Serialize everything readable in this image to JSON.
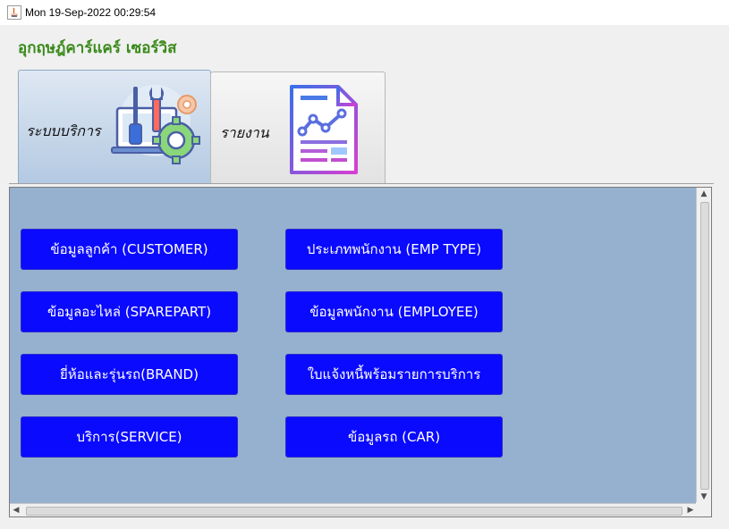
{
  "window": {
    "title": "Mon 19-Sep-2022  00:29:54"
  },
  "app": {
    "heading": "อุกฤษฎ์คาร์แคร์ เซอร์วิส",
    "heading_color": "#3a8a1a"
  },
  "tabs": [
    {
      "label": "ระบบบริการ",
      "icon": "tools-gear-icon",
      "selected": true
    },
    {
      "label": "รายงาน",
      "icon": "report-chart-icon",
      "selected": false
    }
  ],
  "panel": {
    "background": "#95b1cf",
    "buttons": [
      {
        "label": "ข้อมูลลูกค้า (CUSTOMER)"
      },
      {
        "label": "ประเภทพนักงาน (EMP TYPE)"
      },
      {
        "label": "ข้อมูลอะไหล่ (SPAREPART)"
      },
      {
        "label": "ข้อมูลพนักงาน (EMPLOYEE)"
      },
      {
        "label": "ยี่ห้อและรุ่นรถ(BRAND)"
      },
      {
        "label": "ใบแจ้งหนี้พร้อมรายการบริการ"
      },
      {
        "label": "บริการ(SERVICE)"
      },
      {
        "label": "ข้อมูลรถ (CAR)"
      }
    ],
    "button_color": "#0a0aff"
  }
}
